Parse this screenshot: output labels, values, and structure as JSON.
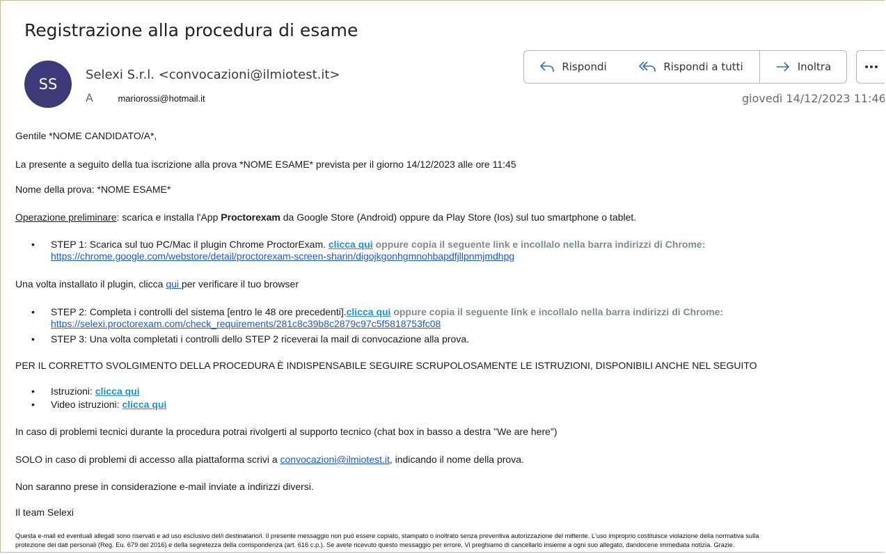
{
  "email": {
    "subject": "Registrazione alla procedura di esame",
    "avatar_initials": "SS",
    "sender": "Selexi S.r.l. <convocazioni@ilmiotest.it>",
    "to_label": "A",
    "to_address": "mariorossi@hotmail.it",
    "date": "giovedì 14/12/2023 11:46",
    "avatar_color": "#3c3a78",
    "actions": {
      "reply": "Rispondi",
      "reply_all": "Rispondi a tutti",
      "forward": "Inoltra",
      "more_icon": "ellipsis-icon"
    }
  },
  "body": {
    "greeting": "Gentile *NOME CANDIDATO/A*,",
    "intro": "La presente a seguito della tua iscrizione alla prova *NOME ESAME* prevista per il giorno 14/12/2023 alle ore 11:45",
    "exam_name": "Nome della prova: *NOME ESAME*",
    "prelim_label": "Operazione preliminare",
    "prelim_text_1": ": scarica e installa l'App ",
    "prelim_app": "Proctorexam",
    "prelim_text_2": " da Google Store (Android) oppure da Play Store (Ios) sul tuo smartphone o tablet.",
    "step1_text": "STEP 1: Scarica sul tuo PC/Mac il plugin Chrome ProctorExam. ",
    "click_here": "clicca qui",
    "copy_link_text": " oppure copia il seguente link e incollalo nella barra indirizzi di Chrome:",
    "step1_link": "https://chrome.google.com/webstore/detail/proctorexam-screen-sharin/digojkgonhgmnohbapdfjllpnmjmdhpg",
    "plugin_text_1": "Una volta installato il plugin, clicca ",
    "plugin_link": " qui ",
    "plugin_text_2": "per verificare il tuo browser",
    "step2_text": "STEP 2: Completa i controlli del sistema [entro le 48 ore precedenti].",
    "step2_link": "https://selexi.proctorexam.com/check_requirements/281c8c39b8c2879c97c5f5818753fc08",
    "step3_text": "STEP 3: Una volta completati i controlli dello STEP 2 riceverai la mail di convocazione alla prova.",
    "warning": "PER IL CORRETTO SVOLGIMENTO DELLA PROCEDURA È INDISPENSABILE SEGUIRE SCRUPOLOSAMENTE LE ISTRUZIONI, DISPONIBILI ANCHE NEL SEGUITO",
    "instructions_label": "Istruzioni: ",
    "video_label": "Video istruzioni: ",
    "support": "In caso di problemi tecnici durante la procedura potrai rivolgerti al supporto tecnico (chat box in basso a destra \"We are here\")",
    "access_text_1": "SOLO in caso di problemi di accesso alla piattaforma scrivi a ",
    "access_email": "convocazioni@ilmiotest.it",
    "access_text_2": ", indicando il nome della prova.",
    "ignored": "Non saranno prese in considerazione e-mail inviate a indirizzi diversi.",
    "signature": "Il team Selexi",
    "disclaimer_1": "Questa e-mail ed eventuali allegati sono riservati e ad uso esclusivo del/i destinatario/i. Il presente messaggio non può essere copiato, stampato o inoltrato senza preventiva autorizzazione del mittente. L'uso improprio costituisce violazione della normativa sulla",
    "disclaimer_2": "protezione dei dati personali (Reg. Eu. 679 del 2016) e della segretezza della corrispondenza (art. 616 c.p.). Se avete ricevuto questo messaggio per errore, Vi preghiamo di cancellarlo insieme a ogni suo allegato, dandocene immediata notizia. Grazie."
  }
}
